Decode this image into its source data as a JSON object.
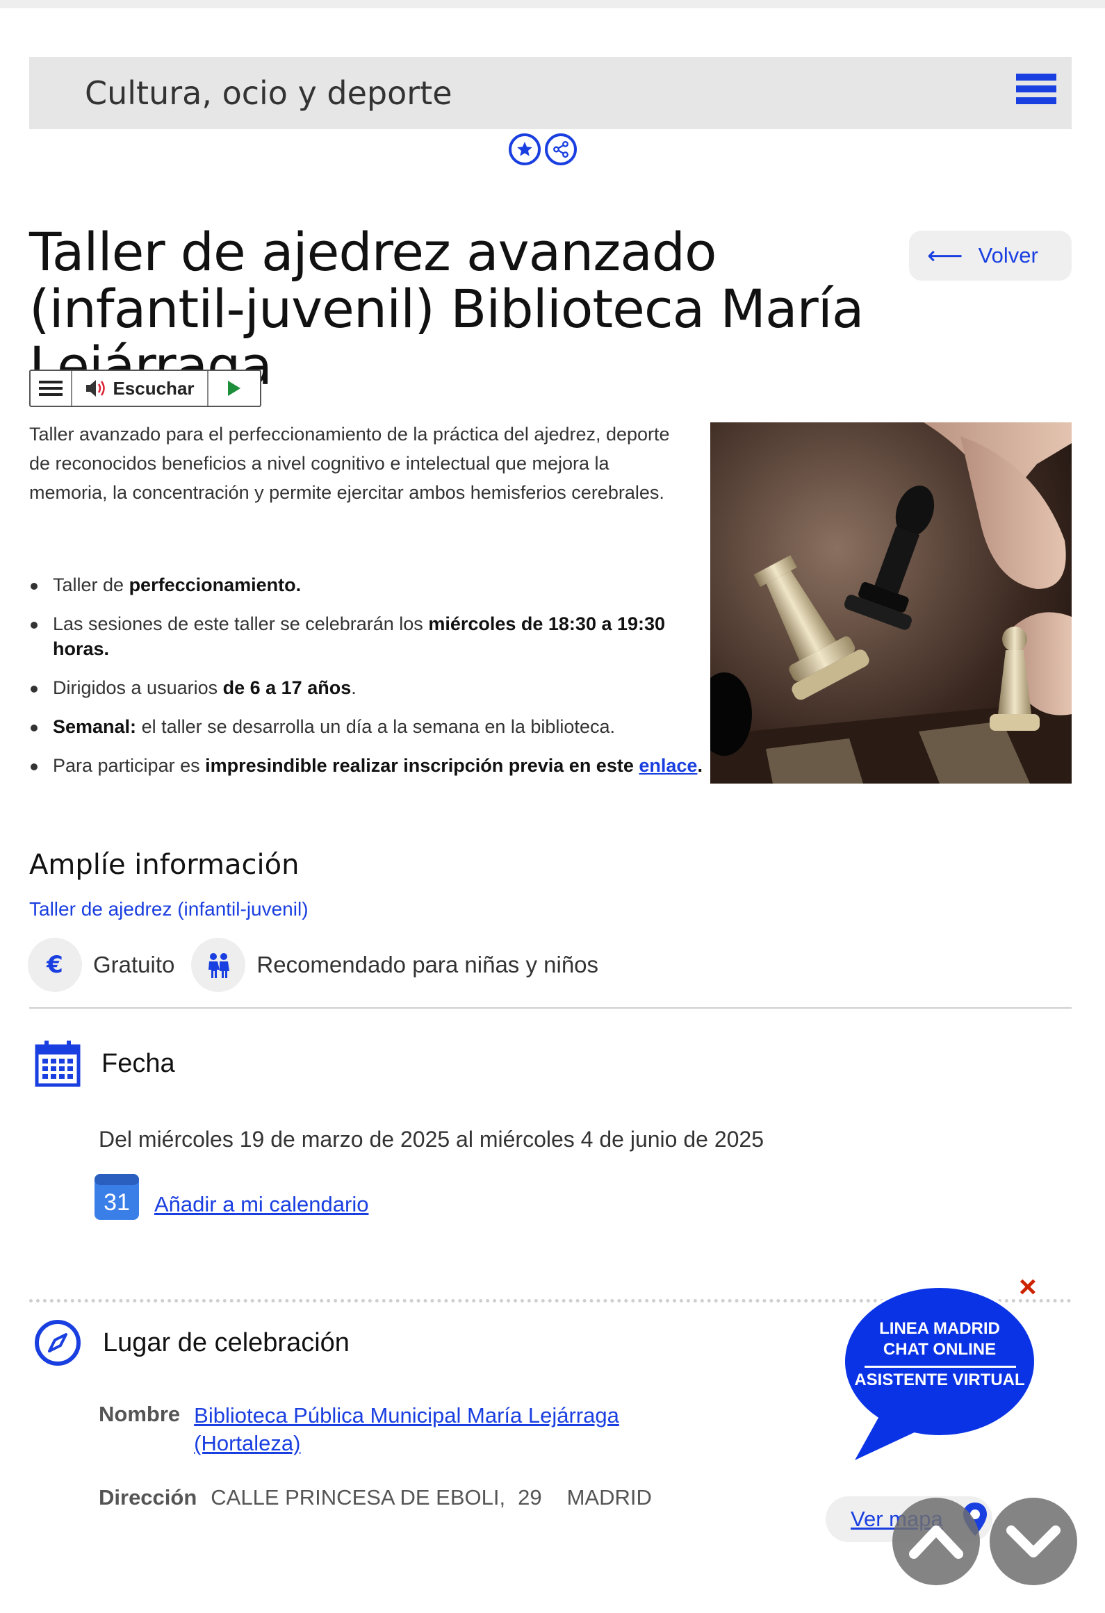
{
  "header": {
    "section_title": "Cultura, ocio y deporte"
  },
  "actions": {
    "favorite_icon": "star-icon",
    "share_icon": "share-icon"
  },
  "page": {
    "title": "Taller de ajedrez avanzado (infantil-juvenil) Biblioteca María Lejárraga",
    "back_label": "Volver"
  },
  "listen": {
    "label": "Escuchar"
  },
  "intro": "Taller avanzado para el perfeccionamiento de la práctica del ajedrez, deporte de reconocidos beneficios a nivel cognitivo e intelectual que mejora la memoria, la concentración y permite ejercitar ambos hemisferios cerebrales.",
  "bullets": [
    {
      "pre": "Taller de ",
      "bold": "perfeccionamiento.",
      "post": ""
    },
    {
      "pre": "Las sesiones de este taller se celebrarán los ",
      "bold": "miércoles de 18:30 a 19:30 horas.",
      "post": ""
    },
    {
      "pre": "Dirigidos a usuarios ",
      "bold": "de 6 a 17 años",
      "post": "."
    },
    {
      "pre": "",
      "bold": "Semanal:",
      "post": " el taller se desarrolla un día a la semana en la biblioteca."
    },
    {
      "pre": "Para participar es ",
      "bold": "impresindible realizar inscripción previa en este",
      "link": "enlace",
      "post": "."
    }
  ],
  "more_info": {
    "title": "Amplíe información",
    "link": "Taller de ajedrez (infantil-juvenil)"
  },
  "tags": [
    {
      "icon": "euro-icon",
      "label": "Gratuito"
    },
    {
      "icon": "children-icon",
      "label": "Recomendado para niñas y niños"
    }
  ],
  "date_section": {
    "heading": "Fecha",
    "range": "Del miércoles 19 de marzo de 2025 al miércoles 4 de junio de 2025",
    "calendar_day": "31",
    "calendar_link": "Añadir a mi calendario"
  },
  "place_section": {
    "heading": "Lugar de celebración",
    "name_label": "Nombre",
    "name_value": "Biblioteca Pública Municipal María Lejárraga (Hortaleza)",
    "address_label": "Dirección",
    "address_street": "CALLE  PRINCESA DE EBOLI,",
    "address_number": "29",
    "address_city": "MADRID",
    "map_label": "Ver mapa"
  },
  "chat": {
    "line1": "LINEA MADRID",
    "line2": "CHAT ONLINE",
    "line3": "ASISTENTE VIRTUAL",
    "close": "×"
  },
  "colors": {
    "accent": "#1a3fe0",
    "bar": "#e6e6e6",
    "chat_bubble": "#0a33e6",
    "close": "#cc2200"
  }
}
